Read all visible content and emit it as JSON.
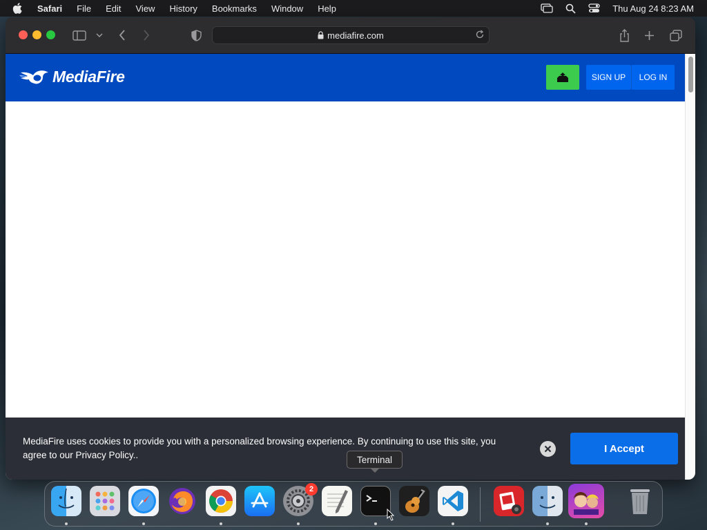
{
  "menubar": {
    "app": "Safari",
    "items": [
      "File",
      "Edit",
      "View",
      "History",
      "Bookmarks",
      "Window",
      "Help"
    ],
    "clock": "Thu Aug 24  8:23 AM"
  },
  "browser": {
    "url": "mediafire.com"
  },
  "site": {
    "logo_text": "MediaFire",
    "signup_label": "SIGN UP",
    "login_label": "LOG IN",
    "upload_color": "#3ccb4c",
    "brand_color": "#0049bf"
  },
  "cookie_banner": {
    "message": "MediaFire uses cookies to provide you with a personalized browsing experience. By continuing to use this site, you agree to our Privacy Policy..",
    "accept_label": "I Accept",
    "accept_color": "#0a6ee8"
  },
  "tooltip": {
    "text": "Terminal"
  },
  "dock": {
    "items": [
      "finder-icon",
      "launchpad-icon",
      "safari-icon",
      "firefox-icon",
      "chrome-icon",
      "app-store-icon",
      "system-preferences-icon",
      "textedit-icon",
      "terminal-icon",
      "garageband-icon",
      "vscode-icon",
      "photo-booth-icon",
      "finder-alt-icon",
      "game-icon",
      "trash-icon"
    ],
    "settings_badge": "2"
  }
}
